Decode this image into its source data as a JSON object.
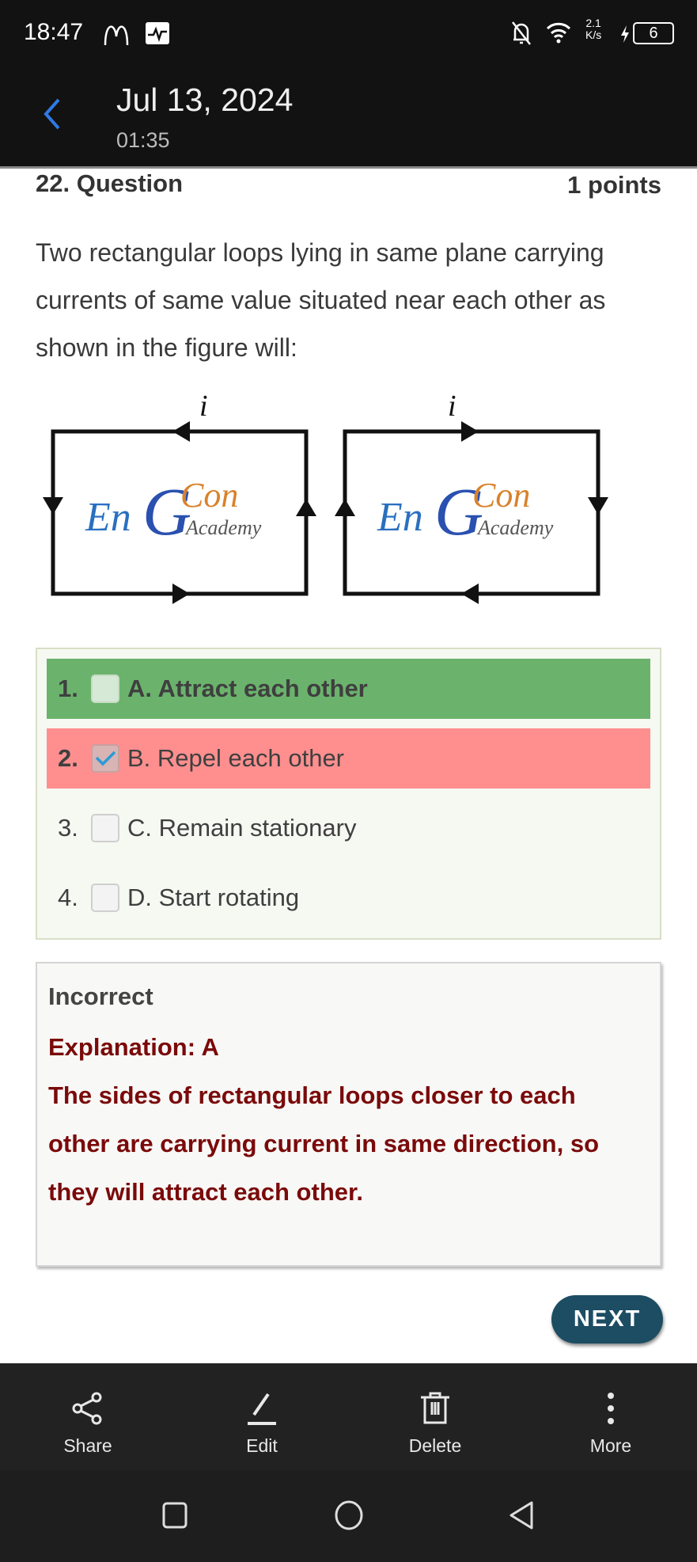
{
  "status_bar": {
    "time": "18:47",
    "net_speed_value": "2.1",
    "net_speed_unit": "K/s",
    "battery": "6",
    "icons": [
      "mcdonalds-icon",
      "activity-icon",
      "bell-off-icon",
      "wifi-icon",
      "charging-icon",
      "battery-icon"
    ]
  },
  "header": {
    "date": "Jul 13, 2024",
    "time": "01:35",
    "back_icon": "chevron-left-icon",
    "accent": "#2f7ae5"
  },
  "question": {
    "number_label": "22. Question",
    "points": "1 points",
    "text_lines": [
      "Two rectangular loops lying in same plane carrying",
      "currents of same value situated near each other as",
      "shown in the figure will:"
    ],
    "figure": {
      "current_label_left": "i",
      "current_label_right": "i",
      "logo_text": "EnGeeCon Academy"
    }
  },
  "options": [
    {
      "num": "1.",
      "label": "A. Attract each other",
      "checked": false,
      "state": "correct",
      "color": "#6bb36c"
    },
    {
      "num": "2.",
      "label": "B. Repel each other",
      "checked": true,
      "state": "incorrect",
      "color": "#ff8f8f"
    },
    {
      "num": "3.",
      "label": "C. Remain stationary",
      "checked": false
    },
    {
      "num": "4.",
      "label": "D. Start rotating",
      "checked": false
    }
  ],
  "feedback": {
    "result": "Incorrect",
    "explanation_title": "Explanation: A",
    "explanation_lines": [
      "The sides of rectangular loops closer to each",
      "other are carrying current in same direction, so",
      "they will attract each other."
    ]
  },
  "next_label": "NEXT",
  "actions": [
    {
      "label": "Share",
      "icon": "share-icon"
    },
    {
      "label": "Edit",
      "icon": "edit-icon"
    },
    {
      "label": "Delete",
      "icon": "trash-icon"
    },
    {
      "label": "More",
      "icon": "more-vertical-icon"
    }
  ],
  "nav": [
    "recents-icon",
    "home-icon",
    "back-icon"
  ]
}
